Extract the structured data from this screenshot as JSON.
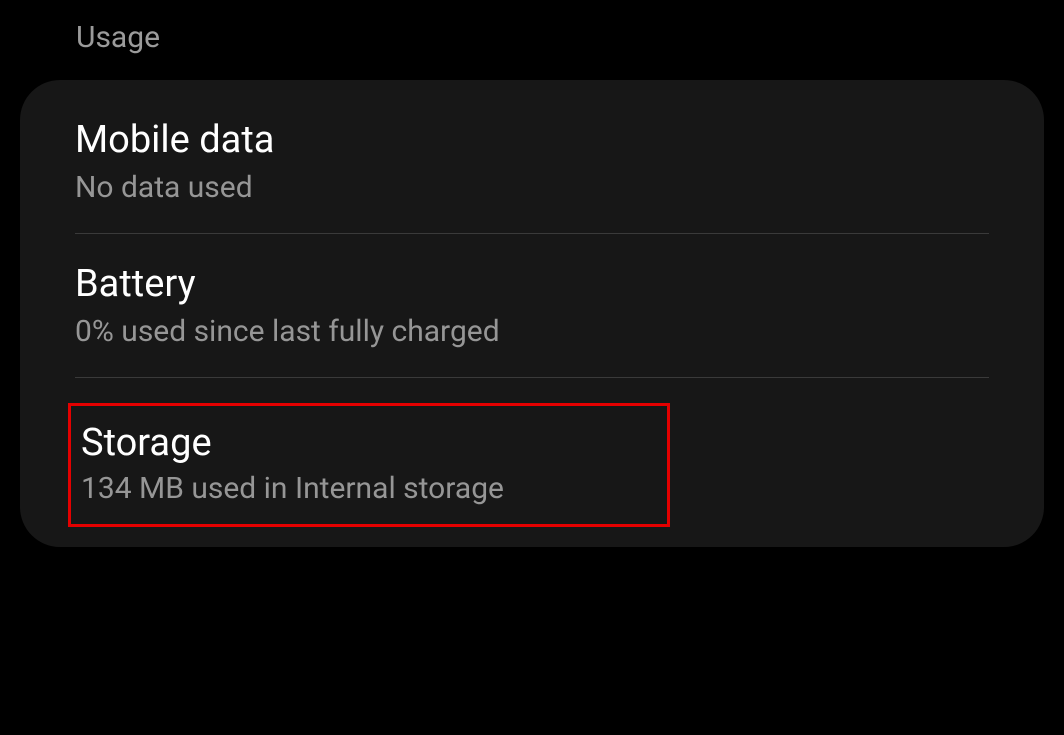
{
  "section": {
    "header": "Usage"
  },
  "items": {
    "mobile_data": {
      "title": "Mobile data",
      "subtitle": "No data used"
    },
    "battery": {
      "title": "Battery",
      "subtitle": "0% used since last fully charged"
    },
    "storage": {
      "title": "Storage",
      "subtitle": "134 MB used in Internal storage"
    }
  }
}
